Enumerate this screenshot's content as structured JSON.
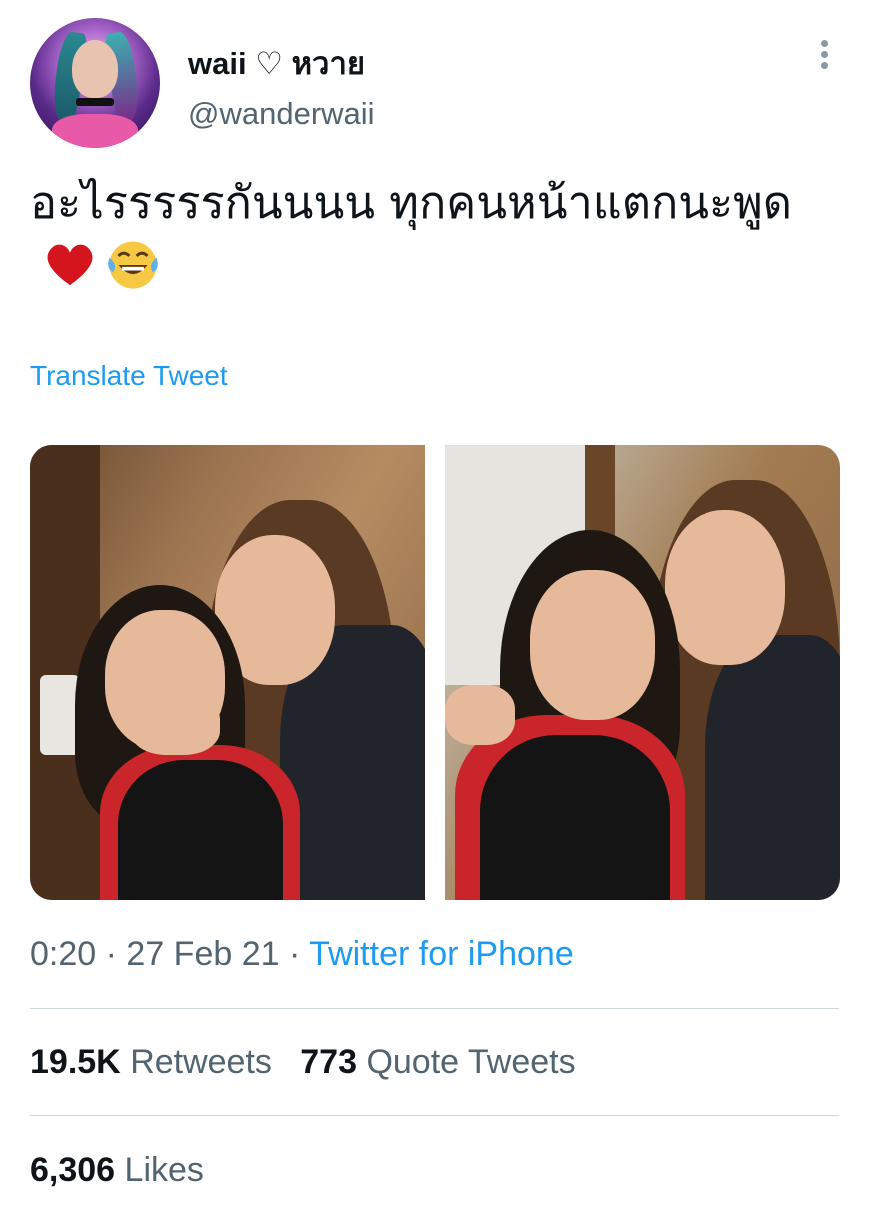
{
  "author": {
    "display_name": "waii ♡ หวาย",
    "handle": "@wanderwaii"
  },
  "tweet": {
    "text": "อะไรรรรรกันนนน ทุกคนหน้าแตกนะพูด",
    "emojis": [
      "heart-icon",
      "laughing-tears-icon"
    ],
    "translate_label": "Translate Tweet",
    "photo_count": 2
  },
  "meta": {
    "time": "0:20",
    "date": "27 Feb 21",
    "separator": "·",
    "source": "Twitter for iPhone"
  },
  "stats": {
    "retweets_count": "19.5K",
    "retweets_label": "Retweets",
    "quotes_count": "773",
    "quotes_label": "Quote Tweets",
    "likes_count": "6,306",
    "likes_label": "Likes"
  },
  "colors": {
    "accent": "#1d9bf0",
    "secondary_text": "#536471",
    "primary_text": "#0f1419",
    "divider": "#cfd9de"
  }
}
